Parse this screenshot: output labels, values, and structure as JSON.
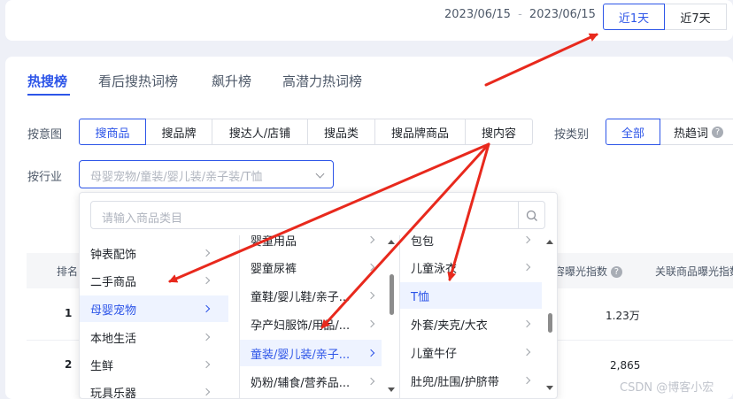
{
  "date_range": {
    "start": "2023/06/15",
    "separator": "-",
    "end": "2023/06/15"
  },
  "period_buttons": [
    "近1天",
    "近7天"
  ],
  "tabs": [
    "热搜榜",
    "看后搜热词榜",
    "飙升榜",
    "高潜力热词榜"
  ],
  "filters": {
    "intent_label": "按意图",
    "intent_options": [
      "搜商品",
      "搜品牌",
      "搜达人/店铺",
      "搜品类",
      "搜品牌商品",
      "搜内容"
    ],
    "category_label": "按类别",
    "category_options": [
      "全部",
      "热趋词"
    ],
    "category_help": "?",
    "industry_label": "按行业",
    "industry_value": "母婴宠物/童装/婴儿装/亲子装/T恤"
  },
  "dropdown": {
    "search_placeholder": "请输入商品类目",
    "col1": [
      "钟表配饰",
      "二手商品",
      "母婴宠物",
      "本地生活",
      "生鲜",
      "玩具乐器"
    ],
    "col2": [
      "婴童用品",
      "婴童尿裤",
      "童鞋/婴儿鞋/亲子...",
      "孕产妇服饰/用品/...",
      "童装/婴儿装/亲子...",
      "奶粉/辅食/营养品..."
    ],
    "col3": [
      "包包",
      "儿童泳衣",
      "T恤",
      "外套/夹克/大衣",
      "儿童牛仔",
      "肚兜/肚围/护脐带"
    ]
  },
  "table": {
    "rank_header": "排名",
    "exposure_header": "容曝光指数",
    "related_header": "关联商品曝光指数",
    "help": "?",
    "rows": [
      {
        "rank": "1",
        "exposure": "1.23万"
      },
      {
        "rank": "2",
        "exposure": "2,865"
      }
    ]
  },
  "watermark": "CSDN @博客小宏",
  "colors": {
    "accent": "#2d55e8",
    "arrow": "#e8291d"
  }
}
